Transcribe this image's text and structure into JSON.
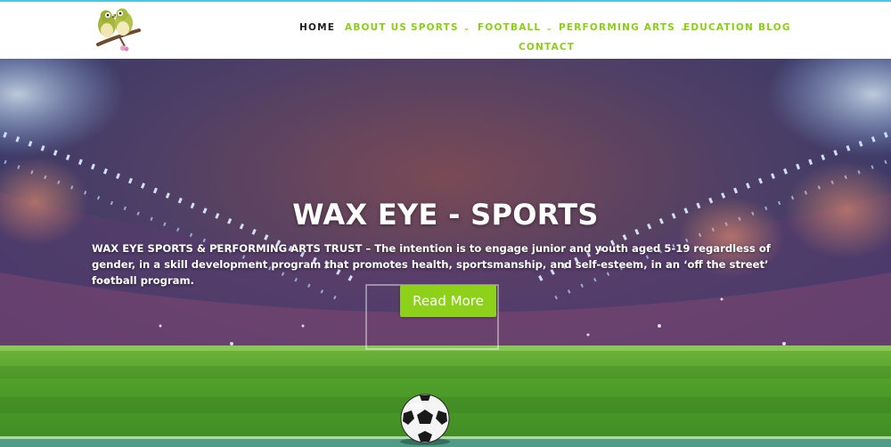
{
  "colors": {
    "accent": "#8ccd18",
    "nav_active": "#1f1f1f",
    "button": "#8ed11a",
    "topline": "#4fc6e0"
  },
  "logo": {
    "icon": "wax-eye-birds-logo-icon"
  },
  "nav": {
    "items": [
      {
        "label": "HOME",
        "active": true
      },
      {
        "label": "ABOUT US"
      },
      {
        "label": "SPORTS",
        "dropdown": true
      },
      {
        "label": "FOOTBALL",
        "dropdown": true
      },
      {
        "label": "PERFORMING ARTS",
        "dropdown": true
      },
      {
        "label": "EDUCATION"
      },
      {
        "label": "BLOG"
      },
      {
        "label": "CONTACT"
      }
    ],
    "chevron": "⌄"
  },
  "hero": {
    "title": "WAX EYE - SPORTS",
    "text": "WAX EYE SPORTS & PERFORMING ARTS TRUST – The intention is to engage junior and youth aged 5-19 regardless of gender, in a skill development program that promotes health, sportsmanship, and self-esteem, in an ‘off the street’ football program.",
    "button": "Read More",
    "background_icon": "stadium-background-image",
    "ball_icon": "soccer-ball-icon"
  }
}
